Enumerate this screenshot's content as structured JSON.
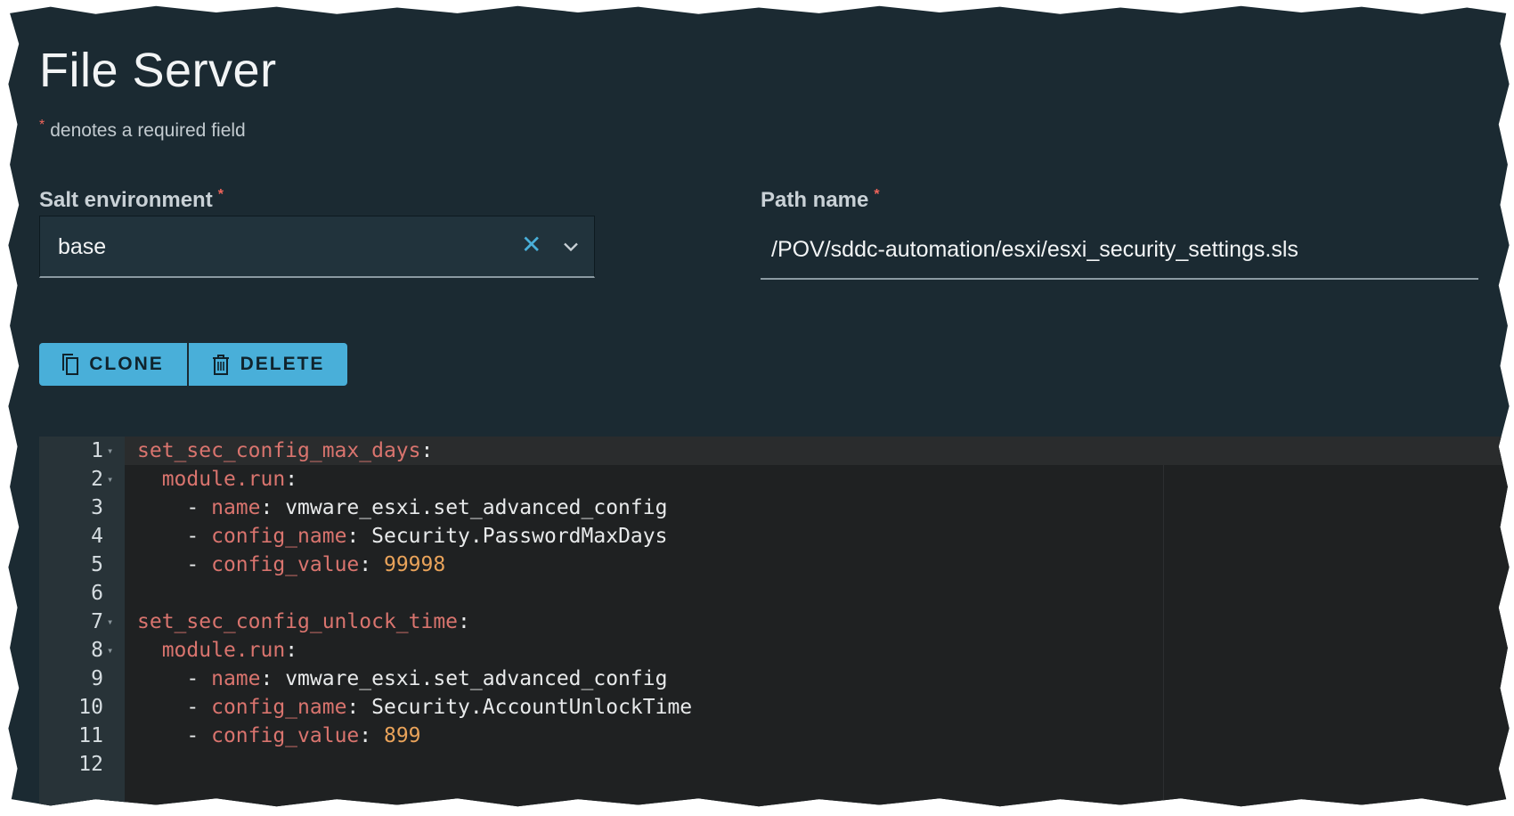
{
  "page": {
    "title": "File Server",
    "required_note": "denotes a required field",
    "required_marker": "*"
  },
  "form": {
    "salt_env_label": "Salt environment",
    "salt_env_value": "base",
    "path_label": "Path name",
    "path_value": "/POV/sddc-automation/esxi/esxi_security_settings.sls"
  },
  "toolbar": {
    "clone_label": "CLONE",
    "delete_label": "DELETE"
  },
  "editor": {
    "lines": [
      {
        "num": "1",
        "fold": true,
        "indent": "",
        "parts": [
          {
            "t": "set_sec_config_max_days",
            "c": "k"
          },
          {
            "t": ":",
            "c": "p"
          }
        ]
      },
      {
        "num": "2",
        "fold": true,
        "indent": "  ",
        "parts": [
          {
            "t": "module.run",
            "c": "k"
          },
          {
            "t": ":",
            "c": "p"
          }
        ]
      },
      {
        "num": "3",
        "fold": false,
        "indent": "    ",
        "parts": [
          {
            "t": "- ",
            "c": "p"
          },
          {
            "t": "name",
            "c": "k"
          },
          {
            "t": ": ",
            "c": "p"
          },
          {
            "t": "vmware_esxi.set_advanced_config",
            "c": "p"
          }
        ]
      },
      {
        "num": "4",
        "fold": false,
        "indent": "    ",
        "parts": [
          {
            "t": "- ",
            "c": "p"
          },
          {
            "t": "config_name",
            "c": "k"
          },
          {
            "t": ": ",
            "c": "p"
          },
          {
            "t": "Security.PasswordMaxDays",
            "c": "p"
          }
        ]
      },
      {
        "num": "5",
        "fold": false,
        "indent": "    ",
        "parts": [
          {
            "t": "- ",
            "c": "p"
          },
          {
            "t": "config_value",
            "c": "k"
          },
          {
            "t": ": ",
            "c": "p"
          },
          {
            "t": "99998",
            "c": "n"
          }
        ]
      },
      {
        "num": "6",
        "fold": false,
        "indent": "",
        "parts": []
      },
      {
        "num": "7",
        "fold": true,
        "indent": "",
        "parts": [
          {
            "t": "set_sec_config_unlock_time",
            "c": "k"
          },
          {
            "t": ":",
            "c": "p"
          }
        ]
      },
      {
        "num": "8",
        "fold": true,
        "indent": "  ",
        "parts": [
          {
            "t": "module.run",
            "c": "k"
          },
          {
            "t": ":",
            "c": "p"
          }
        ]
      },
      {
        "num": "9",
        "fold": false,
        "indent": "    ",
        "parts": [
          {
            "t": "- ",
            "c": "p"
          },
          {
            "t": "name",
            "c": "k"
          },
          {
            "t": ": ",
            "c": "p"
          },
          {
            "t": "vmware_esxi.set_advanced_config",
            "c": "p"
          }
        ]
      },
      {
        "num": "10",
        "fold": false,
        "indent": "    ",
        "parts": [
          {
            "t": "- ",
            "c": "p"
          },
          {
            "t": "config_name",
            "c": "k"
          },
          {
            "t": ": ",
            "c": "p"
          },
          {
            "t": "Security.AccountUnlockTime",
            "c": "p"
          }
        ]
      },
      {
        "num": "11",
        "fold": false,
        "indent": "    ",
        "parts": [
          {
            "t": "- ",
            "c": "p"
          },
          {
            "t": "config_value",
            "c": "k"
          },
          {
            "t": ": ",
            "c": "p"
          },
          {
            "t": "899",
            "c": "n"
          }
        ]
      },
      {
        "num": "12",
        "fold": false,
        "indent": "",
        "parts": []
      }
    ]
  },
  "icons": {
    "clear": "close-icon",
    "dropdown": "chevron-down-icon",
    "clone": "copy-icon",
    "delete": "trash-icon"
  },
  "colors": {
    "background": "#1b2a32",
    "accent": "#49afd9",
    "required": "#f0645a",
    "yaml_key": "#d9746e",
    "yaml_number": "#e9a35a"
  }
}
